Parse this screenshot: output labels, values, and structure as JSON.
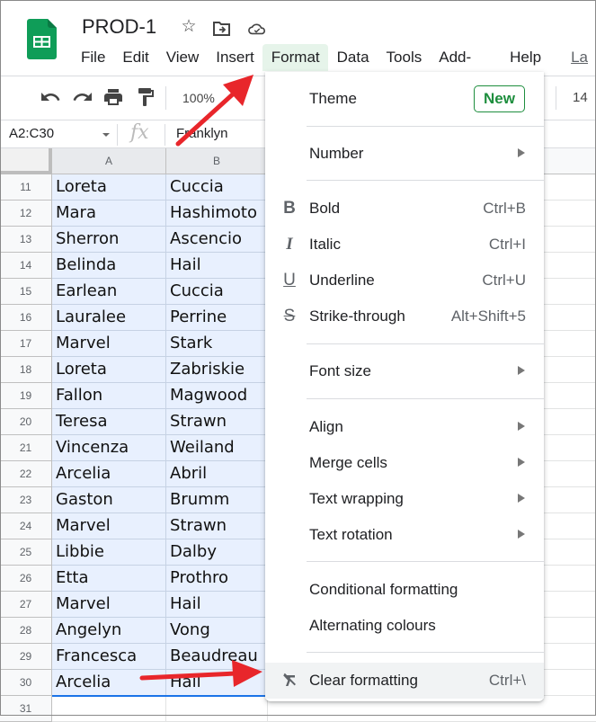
{
  "app": {
    "doc_title": "PROD-1",
    "header_icons": [
      "star-icon",
      "move-to-folder-icon",
      "cloud-saved-icon"
    ]
  },
  "menubar": {
    "items": [
      "File",
      "Edit",
      "View",
      "Insert",
      "Format",
      "Data",
      "Tools",
      "Add-ons",
      "Help"
    ],
    "active": "Format",
    "last_edit_link": "La"
  },
  "toolbar": {
    "zoom": "100%",
    "font_size": "14",
    "icons": [
      "undo-icon",
      "redo-icon",
      "print-icon",
      "paint-format-icon"
    ]
  },
  "formula_bar": {
    "name_box": "A2:C30",
    "fx_label": "fx",
    "content": "Franklyn"
  },
  "grid": {
    "columns": [
      "A",
      "B"
    ],
    "rows": [
      {
        "num": "11",
        "a": "Loreta",
        "b": "Cuccia"
      },
      {
        "num": "12",
        "a": "Mara",
        "b": "Hashimoto"
      },
      {
        "num": "13",
        "a": "Sherron",
        "b": "Ascencio"
      },
      {
        "num": "14",
        "a": "Belinda",
        "b": "Hail"
      },
      {
        "num": "15",
        "a": "Earlean",
        "b": "Cuccia"
      },
      {
        "num": "16",
        "a": "Lauralee",
        "b": "Perrine"
      },
      {
        "num": "17",
        "a": "Marvel",
        "b": "Stark"
      },
      {
        "num": "18",
        "a": "Loreta",
        "b": "Zabriskie"
      },
      {
        "num": "19",
        "a": "Fallon",
        "b": "Magwood"
      },
      {
        "num": "20",
        "a": "Teresa",
        "b": "Strawn"
      },
      {
        "num": "21",
        "a": "Vincenza",
        "b": "Weiland"
      },
      {
        "num": "22",
        "a": "Arcelia",
        "b": "Abril"
      },
      {
        "num": "23",
        "a": "Gaston",
        "b": "Brumm"
      },
      {
        "num": "24",
        "a": "Marvel",
        "b": "Strawn"
      },
      {
        "num": "25",
        "a": "Libbie",
        "b": "Dalby"
      },
      {
        "num": "26",
        "a": "Etta",
        "b": "Prothro"
      },
      {
        "num": "27",
        "a": "Marvel",
        "b": "Hail"
      },
      {
        "num": "28",
        "a": "Angelyn",
        "b": "Vong"
      },
      {
        "num": "29",
        "a": "Francesca",
        "b": "Beaudreau"
      },
      {
        "num": "30",
        "a": "Arcelia",
        "b": "Hail"
      },
      {
        "num": "31",
        "a": "",
        "b": ""
      }
    ]
  },
  "format_menu": {
    "theme": {
      "label": "Theme",
      "badge": "New"
    },
    "number": {
      "label": "Number"
    },
    "bold": {
      "label": "Bold",
      "shortcut": "Ctrl+B",
      "icon": "bold-icon"
    },
    "italic": {
      "label": "Italic",
      "shortcut": "Ctrl+I",
      "icon": "italic-icon"
    },
    "underline": {
      "label": "Underline",
      "shortcut": "Ctrl+U",
      "icon": "underline-icon"
    },
    "strike": {
      "label": "Strike-through",
      "shortcut": "Alt+Shift+5",
      "icon": "strikethrough-icon"
    },
    "font_size": {
      "label": "Font size"
    },
    "align": {
      "label": "Align"
    },
    "merge": {
      "label": "Merge cells"
    },
    "wrapping": {
      "label": "Text wrapping"
    },
    "rotation": {
      "label": "Text rotation"
    },
    "conditional": {
      "label": "Conditional formatting"
    },
    "alternating": {
      "label": "Alternating colours"
    },
    "clear": {
      "label": "Clear formatting",
      "shortcut": "Ctrl+\\",
      "icon": "clear-formatting-icon"
    }
  },
  "colors": {
    "accent": "#1a73e8",
    "selection_fill": "#e8f0fe",
    "new_badge": "#1e8e3e",
    "active_menu_bg": "#e6f4ea",
    "annotation_arrow": "#e8262b"
  }
}
